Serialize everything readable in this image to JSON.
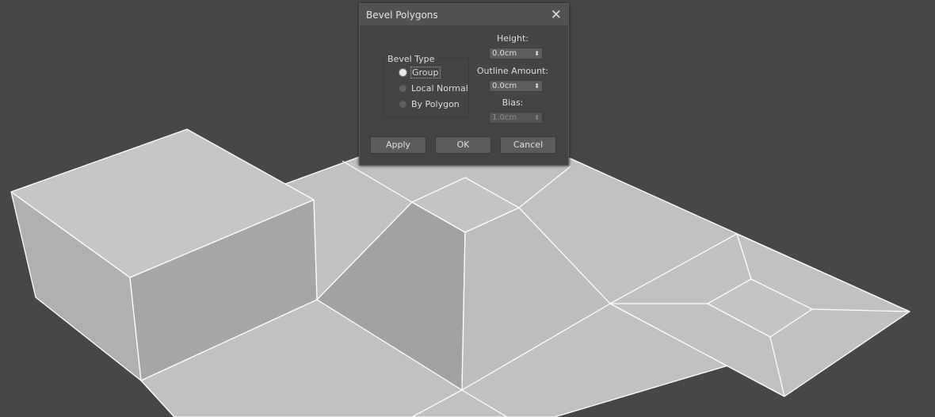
{
  "dialog": {
    "title": "Bevel Polygons",
    "bevel_type": {
      "label": "Bevel Type",
      "options": [
        "Group",
        "Local Normal",
        "By Polygon"
      ],
      "selected": "Group"
    },
    "height": {
      "label": "Height:",
      "value": "0.0cm"
    },
    "outline": {
      "label": "Outline Amount:",
      "value": "0.0cm"
    },
    "bias": {
      "label": "Bias:",
      "value": "1.0cm",
      "disabled": true
    },
    "buttons": {
      "apply": "Apply",
      "ok": "OK",
      "cancel": "Cancel"
    }
  },
  "colors": {
    "viewport": "#474747",
    "surface": "#c0c0c0",
    "edge": "#ffffff"
  }
}
